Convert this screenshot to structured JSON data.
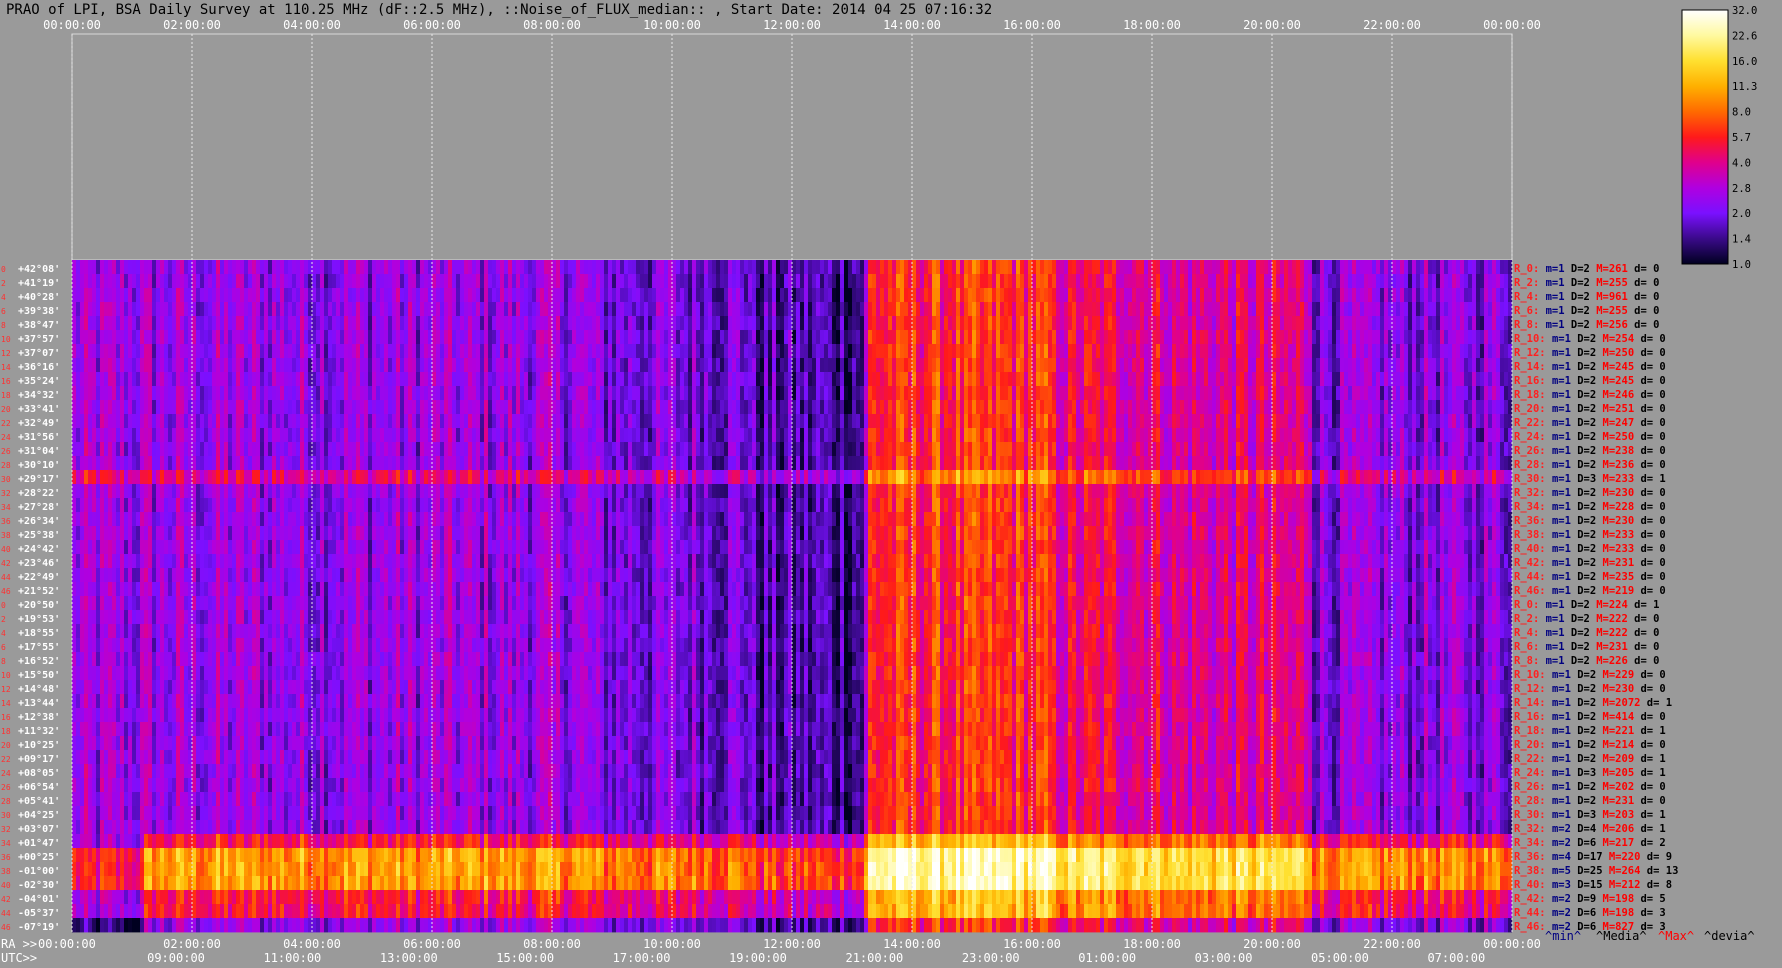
{
  "title": "PRAO of LPI, BSA Daily Survey at 110.25 MHz (dF::2.5 MHz), ::Noise_of_FLUX_median:: , Start Date: 2014 04 25 07:16:32",
  "chart_data": {
    "type": "heatmap",
    "top_axis_ra": [
      "00:00:00",
      "02:00:00",
      "04:00:00",
      "06:00:00",
      "08:00:00",
      "10:00:00",
      "12:00:00",
      "14:00:00",
      "16:00:00",
      "18:00:00",
      "20:00:00",
      "22:00:00",
      "00:00:00"
    ],
    "bottom_axis_ra": [
      "00:00:00",
      "02:00:00",
      "04:00:00",
      "06:00:00",
      "08:00:00",
      "10:00:00",
      "12:00:00",
      "14:00:00",
      "16:00:00",
      "18:00:00",
      "20:00:00",
      "22:00:00",
      "00:00:00"
    ],
    "bottom_axis_utc": [
      "09:00:00",
      "11:00:00",
      "13:00:00",
      "15:00:00",
      "17:00:00",
      "19:00:00",
      "21:00:00",
      "23:00:00",
      "01:00:00",
      "03:00:00",
      "05:00:00",
      "07:00:00"
    ],
    "ra_axis_prefix": "RA >>",
    "utc_axis_prefix": "UTC>>",
    "declinations": [
      "+42°08'",
      "+41°19'",
      "+40°28'",
      "+39°38'",
      "+38°47'",
      "+37°57'",
      "+37°07'",
      "+36°16'",
      "+35°24'",
      "+34°32'",
      "+33°41'",
      "+32°49'",
      "+31°56'",
      "+31°04'",
      "+30°10'",
      "+29°17'",
      "+28°22'",
      "+27°28'",
      "+26°34'",
      "+25°38'",
      "+24°42'",
      "+23°46'",
      "+22°49'",
      "+21°52'",
      "+20°50'",
      "+19°53'",
      "+18°55'",
      "+17°55'",
      "+16°52'",
      "+15°50'",
      "+14°48'",
      "+13°44'",
      "+12°38'",
      "+11°32'",
      "+10°25'",
      "+09°17'",
      "+08°05'",
      "+06°54'",
      "+05°41'",
      "+04°25'",
      "+03°07'",
      "+01°47'",
      "+00°25'",
      "-01°00'",
      "-02°30'",
      "-04°01'",
      "-05°37'",
      "-07°19'"
    ],
    "beam_index": [
      "0",
      "2",
      "4",
      "6",
      "8",
      "10",
      "12",
      "14",
      "16",
      "18",
      "20",
      "22",
      "24",
      "26",
      "28",
      "30",
      "32",
      "34",
      "36",
      "38",
      "40",
      "42",
      "44",
      "46",
      "0",
      "2",
      "4",
      "6",
      "8",
      "10",
      "12",
      "14",
      "16",
      "18",
      "20",
      "22",
      "24",
      "26",
      "28",
      "30",
      "32",
      "34",
      "36",
      "38",
      "40",
      "42",
      "44",
      "46"
    ],
    "colorbar_ticks": [
      "32.0",
      "22.6",
      "16.0",
      "11.3",
      "8.0",
      "5.7",
      "4.0",
      "2.8",
      "2.0",
      "1.4",
      "1.0"
    ],
    "colorbar_colors": [
      "#ffffff",
      "#fff9a0",
      "#ffe030",
      "#ffb000",
      "#ff6a00",
      "#ff1a1a",
      "#e0008c",
      "#b000e0",
      "#7a10ff",
      "#3a0a8a",
      "#000020"
    ],
    "row_stats": [
      {
        "r": "R_0:",
        "m": "1",
        "d": "2",
        "M": "261",
        "dv": "0"
      },
      {
        "r": "R_2:",
        "m": "1",
        "d": "2",
        "M": "255",
        "dv": "0"
      },
      {
        "r": "R_4:",
        "m": "1",
        "d": "2",
        "M": "961",
        "dv": "0"
      },
      {
        "r": "R_6:",
        "m": "1",
        "d": "2",
        "M": "255",
        "dv": "0"
      },
      {
        "r": "R_8:",
        "m": "1",
        "d": "2",
        "M": "256",
        "dv": "0"
      },
      {
        "r": "R_10:",
        "m": "1",
        "d": "2",
        "M": "254",
        "dv": "0"
      },
      {
        "r": "R_12:",
        "m": "1",
        "d": "2",
        "M": "250",
        "dv": "0"
      },
      {
        "r": "R_14:",
        "m": "1",
        "d": "2",
        "M": "245",
        "dv": "0"
      },
      {
        "r": "R_16:",
        "m": "1",
        "d": "2",
        "M": "245",
        "dv": "0"
      },
      {
        "r": "R_18:",
        "m": "1",
        "d": "2",
        "M": "246",
        "dv": "0"
      },
      {
        "r": "R_20:",
        "m": "1",
        "d": "2",
        "M": "251",
        "dv": "0"
      },
      {
        "r": "R_22:",
        "m": "1",
        "d": "2",
        "M": "247",
        "dv": "0"
      },
      {
        "r": "R_24:",
        "m": "1",
        "d": "2",
        "M": "250",
        "dv": "0"
      },
      {
        "r": "R_26:",
        "m": "1",
        "d": "2",
        "M": "238",
        "dv": "0"
      },
      {
        "r": "R_28:",
        "m": "1",
        "d": "2",
        "M": "236",
        "dv": "0"
      },
      {
        "r": "R_30:",
        "m": "1",
        "d": "3",
        "M": "233",
        "dv": "1"
      },
      {
        "r": "R_32:",
        "m": "1",
        "d": "2",
        "M": "230",
        "dv": "0"
      },
      {
        "r": "R_34:",
        "m": "1",
        "d": "2",
        "M": "228",
        "dv": "0"
      },
      {
        "r": "R_36:",
        "m": "1",
        "d": "2",
        "M": "230",
        "dv": "0"
      },
      {
        "r": "R_38:",
        "m": "1",
        "d": "2",
        "M": "233",
        "dv": "0"
      },
      {
        "r": "R_40:",
        "m": "1",
        "d": "2",
        "M": "233",
        "dv": "0"
      },
      {
        "r": "R_42:",
        "m": "1",
        "d": "2",
        "M": "231",
        "dv": "0"
      },
      {
        "r": "R_44:",
        "m": "1",
        "d": "2",
        "M": "235",
        "dv": "0"
      },
      {
        "r": "R_46:",
        "m": "1",
        "d": "2",
        "M": "219",
        "dv": "0"
      },
      {
        "r": "R_0:",
        "m": "1",
        "d": "2",
        "M": "224",
        "dv": "1"
      },
      {
        "r": "R_2:",
        "m": "1",
        "d": "2",
        "M": "222",
        "dv": "0"
      },
      {
        "r": "R_4:",
        "m": "1",
        "d": "2",
        "M": "222",
        "dv": "0"
      },
      {
        "r": "R_6:",
        "m": "1",
        "d": "2",
        "M": "231",
        "dv": "0"
      },
      {
        "r": "R_8:",
        "m": "1",
        "d": "2",
        "M": "226",
        "dv": "0"
      },
      {
        "r": "R_10:",
        "m": "1",
        "d": "2",
        "M": "229",
        "dv": "0"
      },
      {
        "r": "R_12:",
        "m": "1",
        "d": "2",
        "M": "230",
        "dv": "0"
      },
      {
        "r": "R_14:",
        "m": "1",
        "d": "2",
        "M": "2072",
        "dv": "1"
      },
      {
        "r": "R_16:",
        "m": "1",
        "d": "2",
        "M": "414",
        "dv": "0"
      },
      {
        "r": "R_18:",
        "m": "1",
        "d": "2",
        "M": "221",
        "dv": "1"
      },
      {
        "r": "R_20:",
        "m": "1",
        "d": "2",
        "M": "214",
        "dv": "0"
      },
      {
        "r": "R_22:",
        "m": "1",
        "d": "2",
        "M": "209",
        "dv": "1"
      },
      {
        "r": "R_24:",
        "m": "1",
        "d": "3",
        "M": "205",
        "dv": "1"
      },
      {
        "r": "R_26:",
        "m": "1",
        "d": "2",
        "M": "202",
        "dv": "0"
      },
      {
        "r": "R_28:",
        "m": "1",
        "d": "2",
        "M": "231",
        "dv": "0"
      },
      {
        "r": "R_30:",
        "m": "1",
        "d": "3",
        "M": "203",
        "dv": "1"
      },
      {
        "r": "R_32:",
        "m": "2",
        "d": "4",
        "M": "206",
        "dv": "1"
      },
      {
        "r": "R_34:",
        "m": "2",
        "d": "6",
        "M": "217",
        "dv": "2"
      },
      {
        "r": "R_36:",
        "m": "4",
        "d": "17",
        "M": "220",
        "dv": "9"
      },
      {
        "r": "R_38:",
        "m": "5",
        "d": "25",
        "M": "264",
        "dv": "13"
      },
      {
        "r": "R_40:",
        "m": "3",
        "d": "15",
        "M": "212",
        "dv": "8"
      },
      {
        "r": "R_42:",
        "m": "2",
        "d": "9",
        "M": "198",
        "dv": "5"
      },
      {
        "r": "R_44:",
        "m": "2",
        "d": "6",
        "M": "198",
        "dv": "3"
      },
      {
        "r": "R_46:",
        "m": "2",
        "d": "6",
        "M": "827",
        "dv": "3"
      }
    ],
    "stat_prefixes": {
      "min": "m=",
      "median": "D=",
      "max": "M=",
      "dev": "d= "
    },
    "footer_legend": [
      "^min^",
      "^Media^",
      "^Max^",
      "^devia^"
    ],
    "legend_colors": {
      "min": "#000080",
      "median": "#000000",
      "max": "#ff0000",
      "dev": "#000000",
      "row": "#ff2020"
    }
  }
}
